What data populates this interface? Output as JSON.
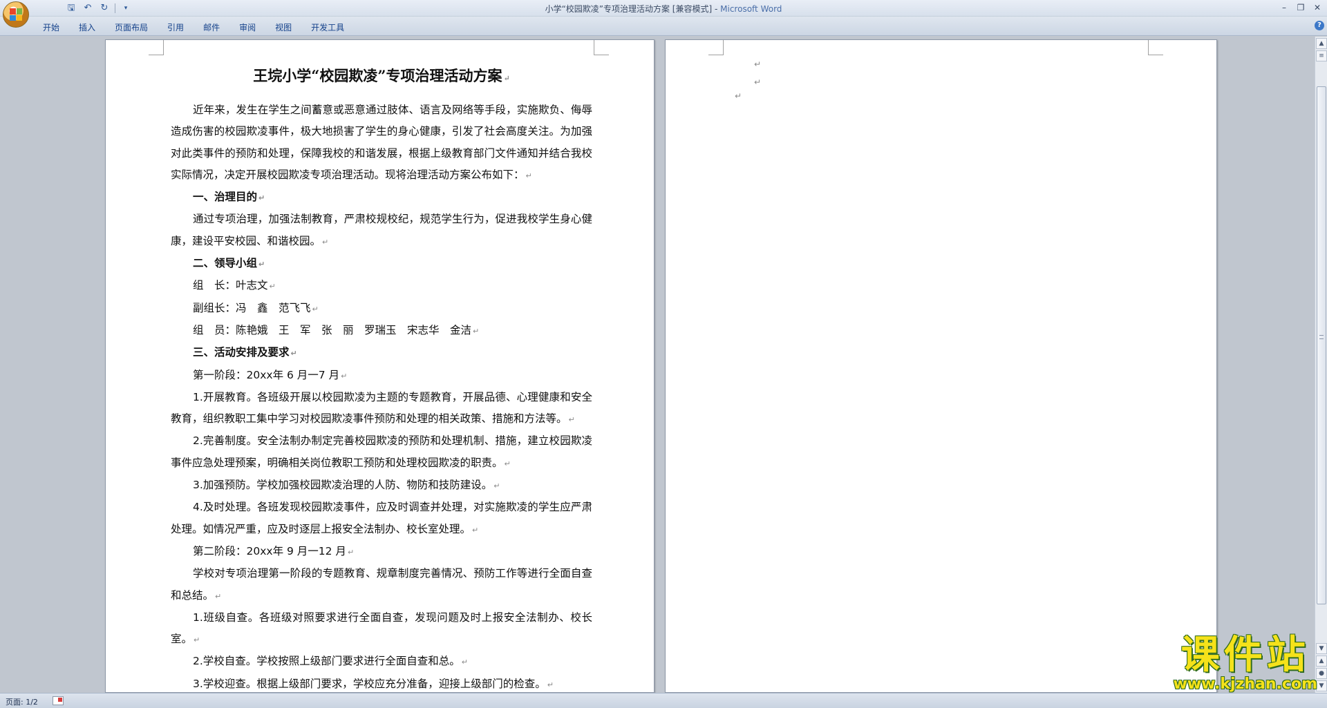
{
  "window": {
    "title_doc": "小学“校园欺凌”专项治理活动方案 [兼容模式] - ",
    "title_app": "Microsoft Word"
  },
  "quick_access": {
    "save_icon": "save-icon",
    "undo_icon": "undo-icon",
    "redo_icon": "redo-icon",
    "customize_icon": "chevron-down-icon"
  },
  "ribbon": {
    "tabs": [
      "开始",
      "插入",
      "页面布局",
      "引用",
      "邮件",
      "审阅",
      "视图",
      "开发工具"
    ]
  },
  "document": {
    "title": "王垸小学“校园欺凌”专项治理活动方案",
    "paragraphs": [
      {
        "text": "近年来，发生在学生之间蓄意或恶意通过肢体、语言及网络等手段，实施欺负、侮辱造成伤害的校园欺凌事件，极大地损害了学生的身心健康，引发了社会高度关注。为加强对此类事件的预防和处理，保障我校的和谐发展，根据上级教育部门文件通知并结合我校实际情况，决定开展校园欺凌专项治理活动。现将治理活动方案公布如下：",
        "style": "ind"
      },
      {
        "text": "一、治理目的",
        "style": "head"
      },
      {
        "text": "通过专项治理，加强法制教育，严肃校规校纪，规范学生行为，促进我校学生身心健康，建设平安校园、和谐校园。",
        "style": "ind"
      },
      {
        "text": "二、领导小组",
        "style": "head"
      },
      {
        "text": "组　长：叶志文",
        "style": "ind"
      },
      {
        "text": "副组长：冯　鑫　范飞飞",
        "style": "ind"
      },
      {
        "text": "组　员：陈艳娥　王　军　张　丽　罗瑞玉　宋志华　金洁",
        "style": "ind"
      },
      {
        "text": "三、活动安排及要求",
        "style": "head"
      },
      {
        "text": "第一阶段：20xx年 6 月一7 月",
        "style": "ind"
      },
      {
        "text": "1.开展教育。各班级开展以校园欺凌为主题的专题教育，开展品德、心理健康和安全教育，组织教职工集中学习对校园欺凌事件预防和处理的相关政策、措施和方法等。",
        "style": "ind"
      },
      {
        "text": "2.完善制度。安全法制办制定完善校园欺凌的预防和处理机制、措施，建立校园欺凌事件应急处理预案，明确相关岗位教职工预防和处理校园欺凌的职责。",
        "style": "ind"
      },
      {
        "text": "3.加强预防。学校加强校园欺凌治理的人防、物防和技防建设。",
        "style": "ind"
      },
      {
        "text": "4.及时处理。各班发现校园欺凌事件，应及时调查并处理，对实施欺凌的学生应严肃处理。如情况严重，应及时逐层上报安全法制办、校长室处理。",
        "style": "ind"
      },
      {
        "text": "第二阶段：20xx年 9 月一12 月",
        "style": "ind"
      },
      {
        "text": "学校对专项治理第一阶段的专题教育、规章制度完善情况、预防工作等进行全面自查和总结。",
        "style": "ind"
      },
      {
        "text": "1.班级自查。各班级对照要求进行全面自查，发现问题及时上报安全法制办、校长室。",
        "style": "ind"
      },
      {
        "text": "2.学校自查。学校按照上级部门要求进行全面自查和总。",
        "style": "ind"
      },
      {
        "text": "3.学校迎查。根据上级部门要求，学校应充分准备，迎接上级部门的检查。",
        "style": "ind"
      }
    ],
    "para_mark": "↵"
  },
  "statusbar": {
    "page_label": "页面: 1/2"
  },
  "watermark": {
    "title": "课件站",
    "url": "www.kjzhan.com"
  },
  "colors": {
    "tab_text": "#15428b",
    "watermark_yellow": "#f5e21a",
    "watermark_outline": "#2f6b1e"
  }
}
